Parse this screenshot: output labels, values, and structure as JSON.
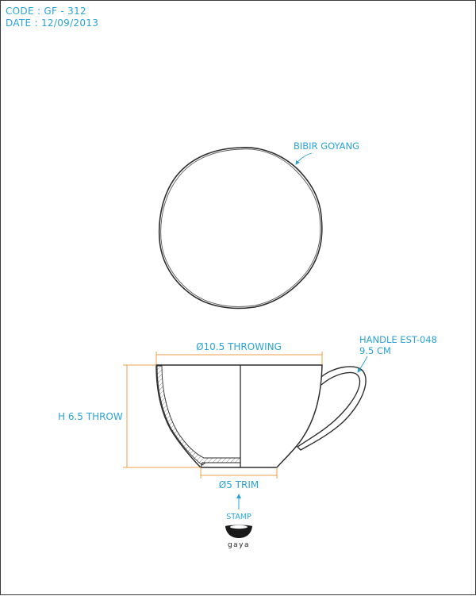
{
  "header": {
    "code": "CODE : GF - 312",
    "date": "DATE : 12/09/2013"
  },
  "annotations": {
    "rim": "BIBIR GOYANG",
    "diameter": "Ø10.5 THROWING",
    "handle_line1": "HANDLE EST-048",
    "handle_line2": "9.5 CM",
    "height": "H 6.5 THROW",
    "foot": "Ø5 TRIM",
    "stamp": "STAMP"
  },
  "logo": {
    "text": "gaya"
  },
  "colors": {
    "annotation": "#2aa3d6",
    "dimension": "#e8a04a",
    "outline": "#2d2d2d"
  }
}
